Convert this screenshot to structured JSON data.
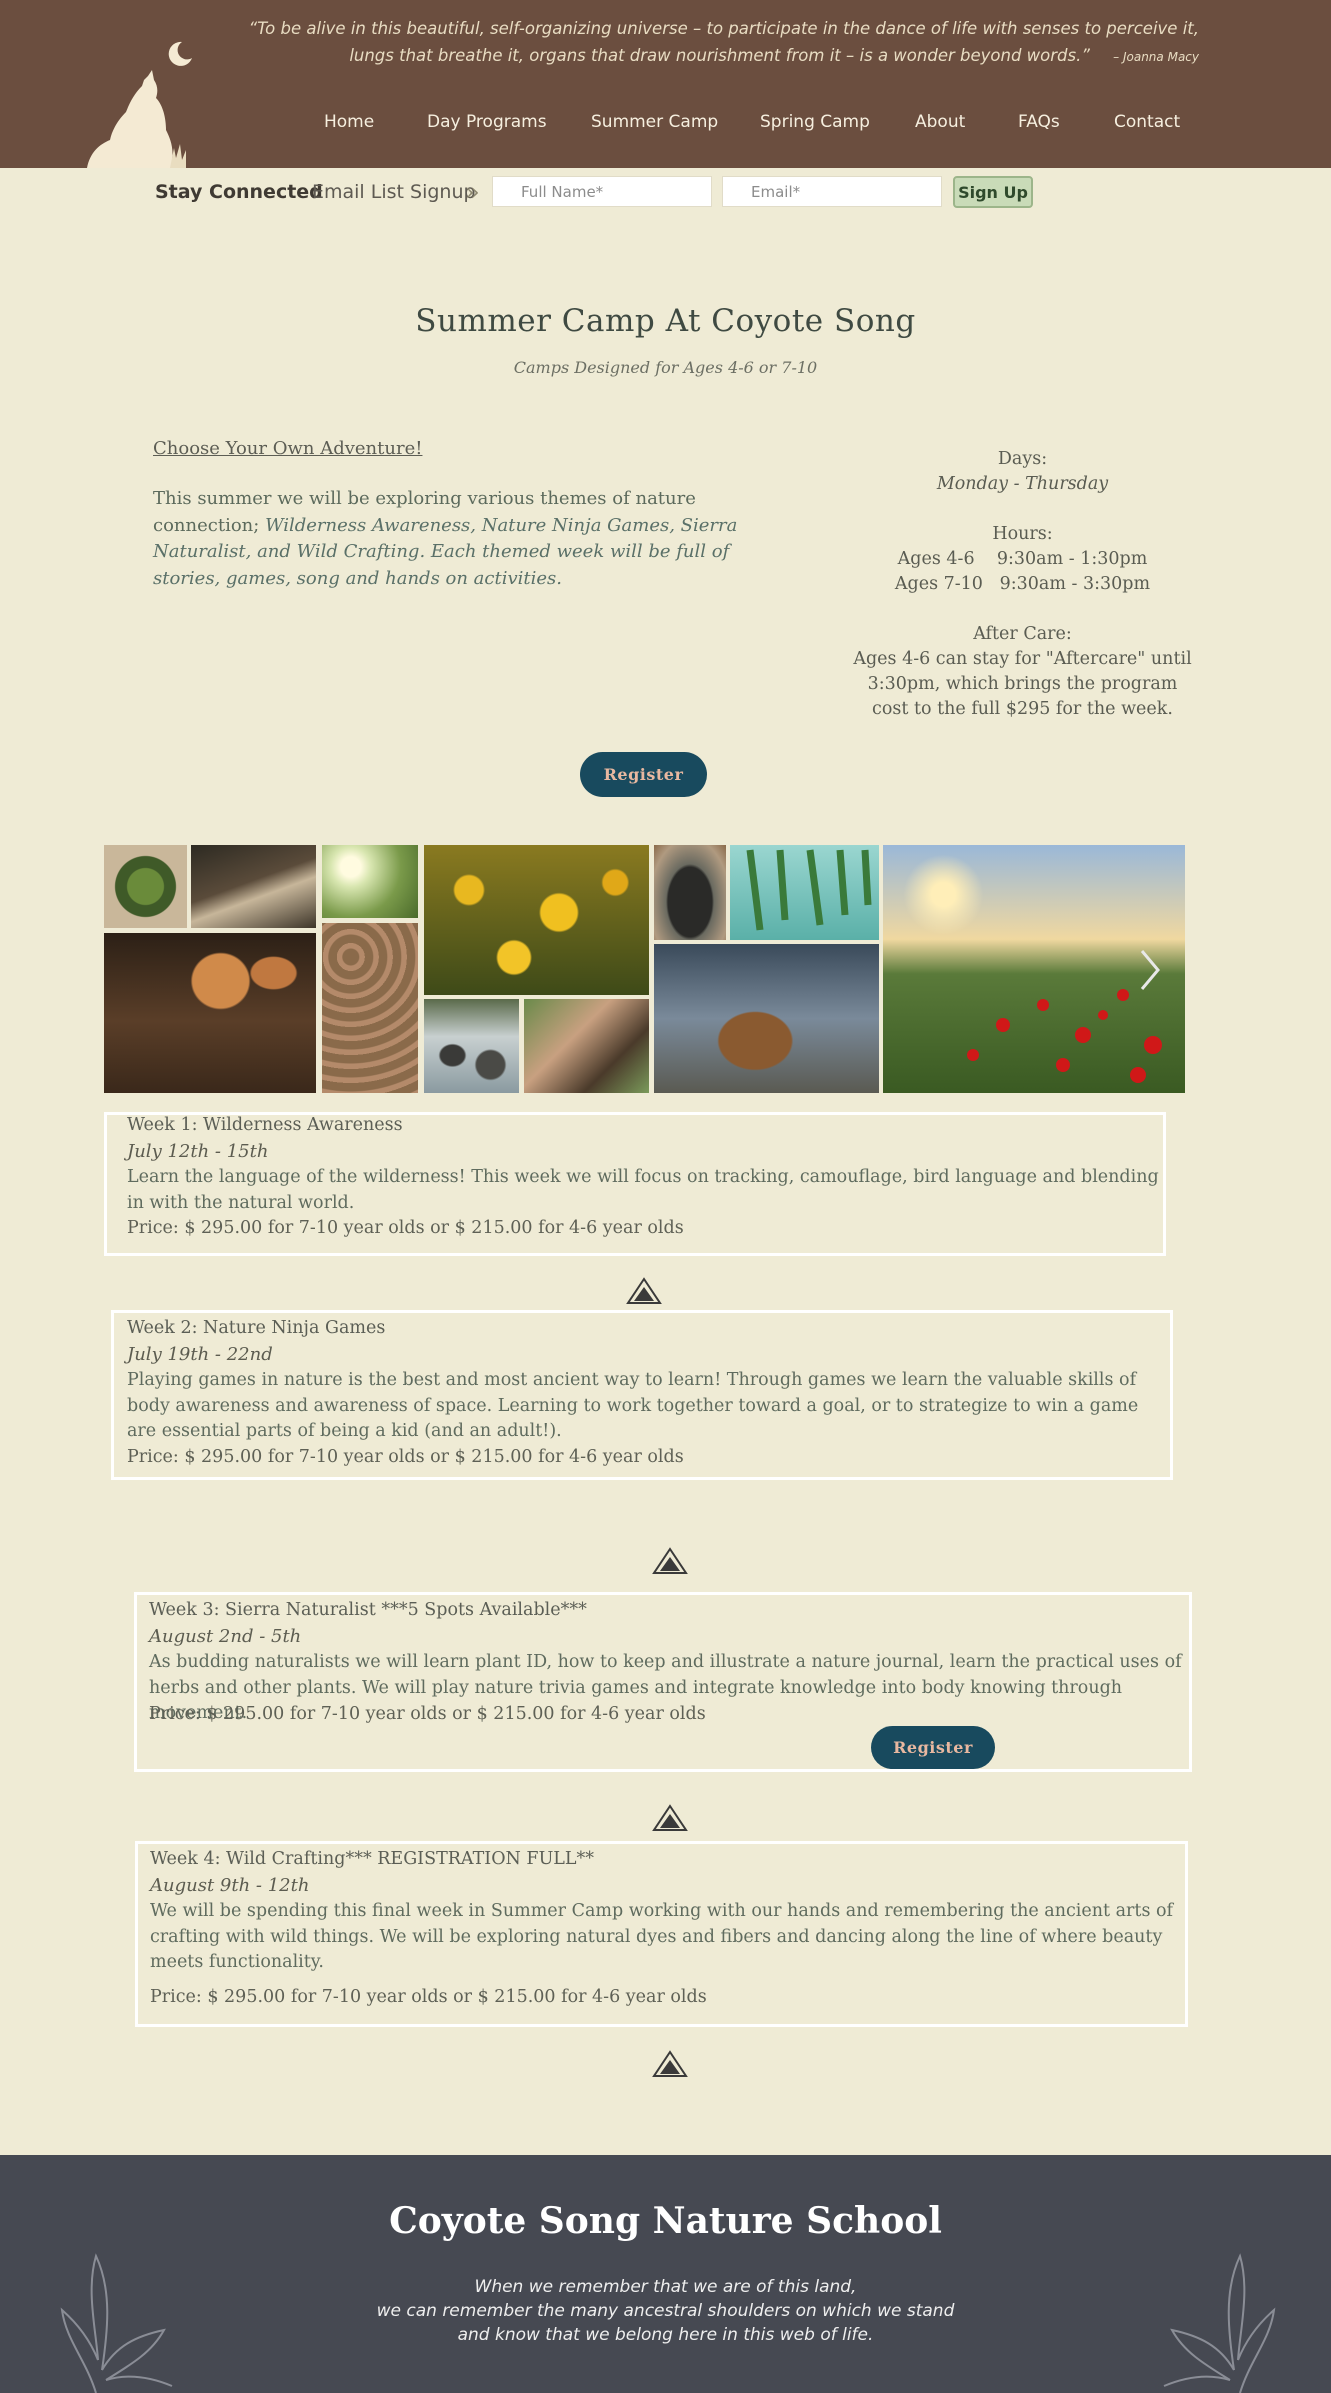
{
  "header": {
    "quote": "“To be alive in this beautiful, self-organizing universe – to participate in the dance of life with senses to perceive it, lungs that breathe it, organs that draw nourishment from it – is a wonder beyond words.”",
    "quote_author": "– Joanna Macy",
    "nav": [
      "Home",
      "Day Programs",
      "Summer Camp",
      "Spring Camp",
      "About",
      "FAQs",
      "Contact"
    ]
  },
  "signup": {
    "heading": "Stay Connected",
    "label": "Email List Signup",
    "name_placeholder": "Full Name*",
    "email_placeholder": "Email*",
    "button": "Sign Up"
  },
  "main": {
    "title": "Summer Camp At Coyote Song",
    "subtitle": "Camps Designed for Ages 4-6 or 7-10",
    "adventure": "Choose Your Own Adventure!",
    "intro_plain": "This summer we will be exploring various themes of nature connection;",
    "intro_italic": "Wilderness Awareness, Nature Ninja Games, Sierra Naturalist, and Wild Crafting. Each themed week will be full of stories, games, song and hands on activities.",
    "days_label": "Days:",
    "days_value": "Monday - Thursday",
    "hours_label": "Hours:",
    "hours_1": "Ages 4-6    9:30am - 1:30pm",
    "hours_2": "Ages 7-10   9:30am - 3:30pm",
    "aftercare_label": "After Care:",
    "aftercare_text": "Ages 4-6 can stay for \"Aftercare\" until 3:30pm, which brings the program cost to the full $295 for the week.",
    "register": "Register"
  },
  "weeks": [
    {
      "title": "Week 1: Wilderness Awareness",
      "dates": "July 12th - 15th",
      "desc": "Learn the language of the wilderness! This week we will focus on tracking, camouflage, bird language and blending in with the natural world.",
      "price": "Price: $ 295.00 for 7-10 year olds or $ 215.00 for 4-6 year olds"
    },
    {
      "title": "Week 2: Nature Ninja Games",
      "dates": "July 19th - 22nd",
      "desc": "Playing games in nature is the best and most ancient way to learn! Through games we learn the valuable skills of body awareness and awareness of space. Learning to work together toward a goal, or to strategize to win a game are essential parts of being a kid (and an adult!).",
      "price": "Price: $ 295.00  for 7-10 year olds or $ 215.00 for 4-6 year olds"
    },
    {
      "title": "Week 3: Sierra Naturalist ***5 Spots Available***",
      "dates": "August 2nd - 5th",
      "desc": "As budding naturalists we will learn plant ID, how to keep and illustrate a nature journal, learn the practical uses of herbs and other plants. We will play nature trivia games and integrate knowledge into body knowing through movement.",
      "price": "Price: $ 295.00 for 7-10 year olds or $ 215.00 for 4-6 year olds",
      "register": "Register"
    },
    {
      "title": "Week 4: Wild Crafting*** REGISTRATION FULL**",
      "dates": "August 9th - 12th",
      "desc": "We will be spending this final week in Summer Camp working with our hands and remembering the ancient arts of crafting with wild things. We will be exploring natural dyes and fibers and dancing along the line of where beauty meets functionality.",
      "price": "Price: $ 295.00 for 7-10 year olds or $ 215.00 for 4-6 year olds"
    }
  ],
  "footer": {
    "title": "Coyote Song Nature School",
    "line1": "When we remember that we are of this land,",
    "line2": "we can remember the many ancestral shoulders on which we stand",
    "line3": "and know that we belong here in this web of life."
  },
  "icons": {
    "logo": "howling-coyote-logo",
    "divider": "mountain-triangle-icon",
    "gallery_next": "chevron-right-icon",
    "footer_leaf": "botanical-leaf-icon"
  },
  "colors": {
    "header_bg": "#6b4e3f",
    "page_bg": "#efebd5",
    "register_bg": "#184a5e",
    "footer_bg": "#464952"
  }
}
